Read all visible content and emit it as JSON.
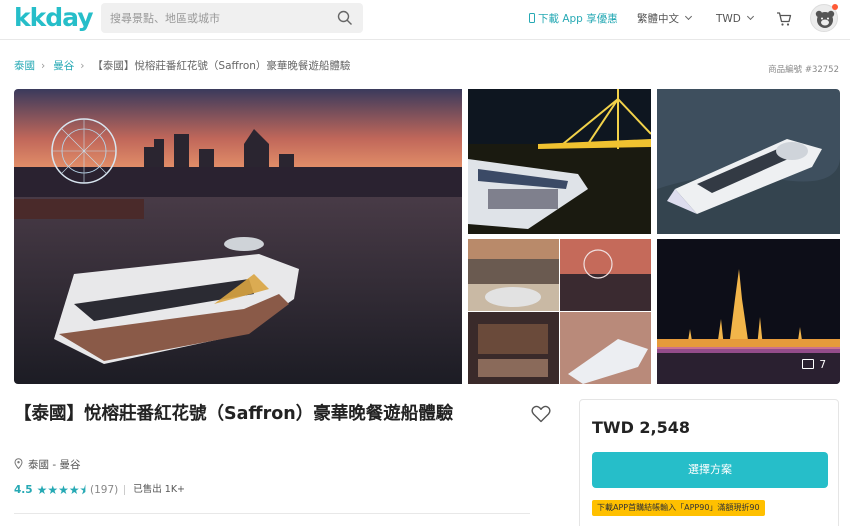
{
  "header": {
    "logo": "kkday",
    "search_placeholder": "搜尋景點、地區或城市",
    "download_app": "下載 App 享優惠",
    "language": "繁體中文",
    "currency": "TWD"
  },
  "breadcrumb": {
    "items": [
      "泰國",
      "曼谷"
    ],
    "current": "【泰國】悅榕莊番紅花號（Saffron）豪華晚餐遊船體驗"
  },
  "product_number": "商品編號 #32752",
  "gallery": {
    "more_photos_count": "7"
  },
  "product": {
    "title": "【泰國】悅榕莊番紅花號（Saffron）豪華晚餐遊船體驗",
    "location": "泰國 - 曼谷",
    "rating": "4.5",
    "rating_value": 4.5,
    "reviews": "(197)",
    "sold": "已售出 1K+"
  },
  "booking": {
    "price": "TWD 2,548",
    "select_label": "選擇方案",
    "promo": "下載APP首購結帳輸入「APP90」滿額現折90"
  },
  "colors": {
    "brand": "#26bec9",
    "promo": "#ffc000"
  }
}
